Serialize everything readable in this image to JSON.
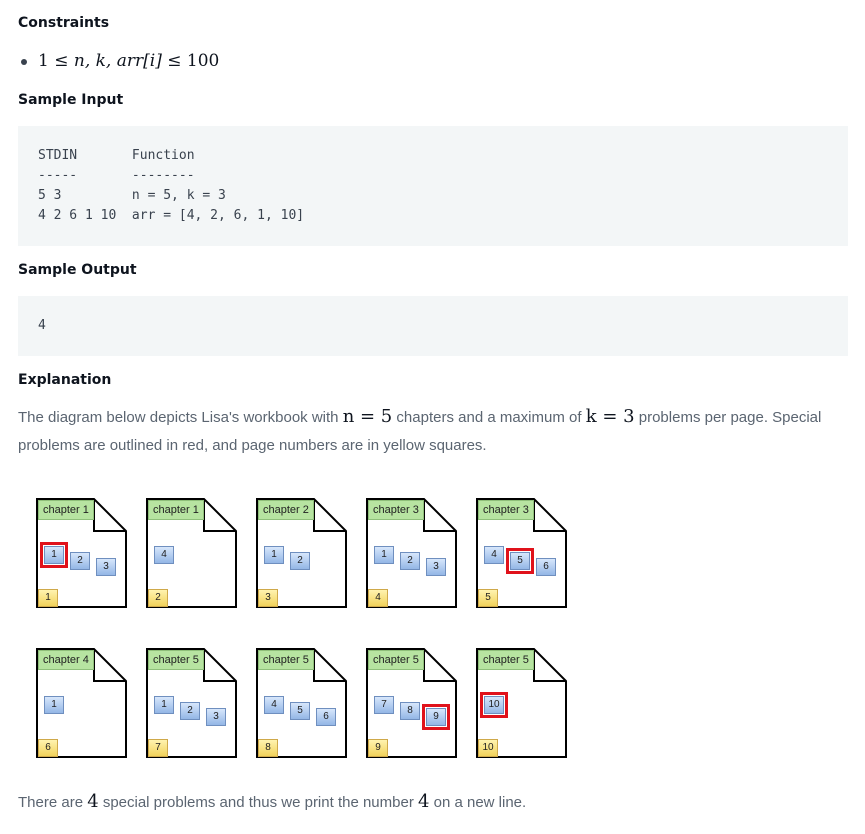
{
  "constraints": {
    "heading": "Constraints",
    "item_prefix": "1 ≤ ",
    "item_vars": "n, k, arr[i]",
    "item_suffix": " ≤ 100"
  },
  "sample_input": {
    "heading": "Sample Input",
    "lines": [
      "STDIN       Function",
      "-----       --------",
      "5 3         n = 5, k = 3",
      "4 2 6 1 10  arr = [4, 2, 6, 1, 10]"
    ]
  },
  "sample_output": {
    "heading": "Sample Output",
    "value": "4"
  },
  "explanation": {
    "heading": "Explanation",
    "p1_a": "The diagram below depicts Lisa's workbook with ",
    "p1_n": "n = 5",
    "p1_b": " chapters and a maximum of ",
    "p1_k": "k = 3",
    "p1_c": " problems per page. Special",
    "p1_d": "problems are outlined in red, and page numbers are in yellow squares.",
    "p2_a": "There are ",
    "p2_num": "4",
    "p2_b": " special problems and thus we print the number ",
    "p2_num2": "4",
    "p2_c": " on a new line."
  },
  "workbook": {
    "pages": [
      {
        "chapter": "chapter 1",
        "page": "1",
        "problems": [
          {
            "n": "1",
            "special": true
          },
          {
            "n": "2",
            "special": false
          },
          {
            "n": "3",
            "special": false
          }
        ]
      },
      {
        "chapter": "chapter 1",
        "page": "2",
        "problems": [
          {
            "n": "4",
            "special": false
          }
        ]
      },
      {
        "chapter": "chapter 2",
        "page": "3",
        "problems": [
          {
            "n": "1",
            "special": false
          },
          {
            "n": "2",
            "special": false
          }
        ]
      },
      {
        "chapter": "chapter 3",
        "page": "4",
        "problems": [
          {
            "n": "1",
            "special": false
          },
          {
            "n": "2",
            "special": false
          },
          {
            "n": "3",
            "special": false
          }
        ]
      },
      {
        "chapter": "chapter 3",
        "page": "5",
        "problems": [
          {
            "n": "4",
            "special": false
          },
          {
            "n": "5",
            "special": true
          },
          {
            "n": "6",
            "special": false
          }
        ]
      },
      {
        "chapter": "chapter 4",
        "page": "6",
        "problems": [
          {
            "n": "1",
            "special": false
          }
        ]
      },
      {
        "chapter": "chapter 5",
        "page": "7",
        "problems": [
          {
            "n": "1",
            "special": false
          },
          {
            "n": "2",
            "special": false
          },
          {
            "n": "3",
            "special": false
          }
        ]
      },
      {
        "chapter": "chapter 5",
        "page": "8",
        "problems": [
          {
            "n": "4",
            "special": false
          },
          {
            "n": "5",
            "special": false
          },
          {
            "n": "6",
            "special": false
          }
        ]
      },
      {
        "chapter": "chapter 5",
        "page": "9",
        "problems": [
          {
            "n": "7",
            "special": false
          },
          {
            "n": "8",
            "special": false
          },
          {
            "n": "9",
            "special": true
          }
        ]
      },
      {
        "chapter": "chapter 5",
        "page": "10",
        "problems": [
          {
            "n": "10",
            "special": true
          }
        ]
      }
    ],
    "colors": {
      "chapter_label": "#b7e4a1",
      "problem_box": "#94b6e6",
      "special_outline": "#e0121b",
      "page_number": "#f2d35c"
    }
  }
}
